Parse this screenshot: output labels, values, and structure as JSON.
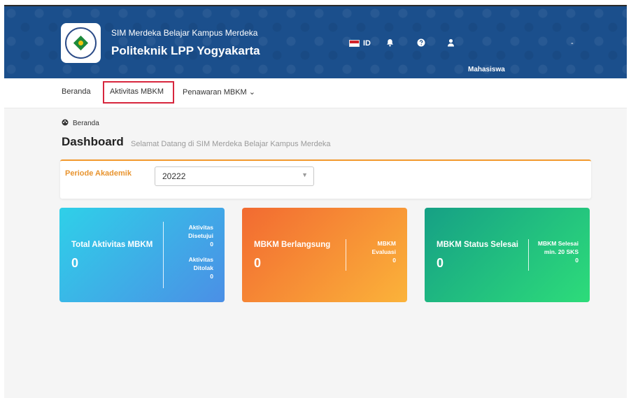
{
  "header": {
    "subtitle": "SIM Merdeka Belajar Kampus Merdeka",
    "title": "Politeknik LPP Yogyakarta",
    "language": "ID",
    "user_role": "Mahasiswa",
    "user_extra": "-"
  },
  "nav": {
    "items": [
      {
        "label": "Beranda"
      },
      {
        "label": "Aktivitas MBKM"
      },
      {
        "label": "Penawaran MBKM"
      }
    ],
    "dropdown_caret": "⌄"
  },
  "breadcrumb": {
    "label": "Beranda"
  },
  "dashboard": {
    "title": "Dashboard",
    "subtitle": "Selamat Datang di SIM Merdeka Belajar Kampus Merdeka"
  },
  "period": {
    "label": "Periode Akademik",
    "value": "20222"
  },
  "cards": [
    {
      "title": "Total Aktivitas MBKM",
      "value": "0",
      "side": [
        {
          "label_line1": "Aktivitas",
          "label_line2": "Disetujui",
          "value": "0"
        },
        {
          "label_line1": "Aktivitas",
          "label_line2": "Ditolak",
          "value": "0"
        }
      ]
    },
    {
      "title": "MBKM Berlangsung",
      "value": "0",
      "side": [
        {
          "label_line1": "MBKM",
          "label_line2": "Evaluasi",
          "value": "0"
        }
      ]
    },
    {
      "title": "MBKM Status Selesai",
      "value": "0",
      "side": [
        {
          "label_line1": "MBKM Selesai",
          "label_line2": "min. 20 SKS",
          "value": "0"
        }
      ]
    }
  ],
  "colors": {
    "header_bg": "#1b4f8c",
    "accent_orange": "#f29a2e",
    "highlight_red": "#d7263d",
    "card1": "#4b8fe6",
    "card2": "#f48a35",
    "card3": "#1fbf7c"
  },
  "icons": [
    "logo",
    "flag-icon",
    "bell-icon",
    "help-icon",
    "user-icon",
    "dashboard-icon",
    "caret-down-icon"
  ]
}
